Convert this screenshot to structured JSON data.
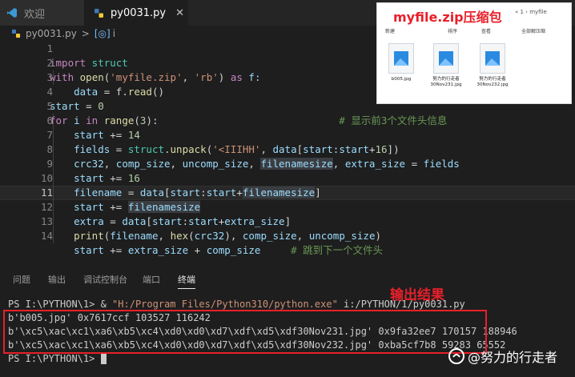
{
  "tabs": [
    {
      "label": "欢迎"
    },
    {
      "label": "py0031.py"
    }
  ],
  "breadcrumb": {
    "file": "py0031.py",
    "sep": ">",
    "symbol": "i"
  },
  "editor": {
    "line_numbers": [
      "1",
      "2",
      "3",
      "4",
      "5",
      "6",
      "7",
      "8",
      "9",
      "10",
      "11",
      "12",
      "13",
      "14"
    ],
    "current_line": "11",
    "code": {
      "l1": [
        "import",
        " struct"
      ],
      "l2": [
        "with",
        " ",
        "open",
        "(",
        "'myfile.zip'",
        ", ",
        "'rb'",
        ") ",
        "as",
        " f:"
      ],
      "l3": [
        "    data",
        " = f.",
        "read",
        "()"
      ],
      "l4": [
        "start",
        " = ",
        "0"
      ],
      "l5": [
        "for",
        " i ",
        "in",
        " ",
        "range",
        "(",
        "3",
        "):",
        "                              # 显示前3个文件头信息"
      ],
      "l6": [
        "    start",
        " += ",
        "14"
      ],
      "l7": [
        "    fields",
        " = ",
        "struct",
        ".",
        "unpack",
        "(",
        "'<IIIHH'",
        ", ",
        "data",
        "[",
        "start",
        ":",
        "start",
        "+",
        "16",
        "])"
      ],
      "l8": [
        "    crc32",
        ", ",
        "comp_size",
        ", ",
        "uncomp_size",
        ", ",
        "filenamesize",
        ", ",
        "extra_size",
        " = ",
        "fields"
      ],
      "l9": [
        "    start",
        " += ",
        "16"
      ],
      "l10": [
        "    filename",
        " = ",
        "data",
        "[",
        "start",
        ":",
        "start",
        "+",
        "filenamesize",
        "]"
      ],
      "l11": [
        "    start",
        " += ",
        "filenamesize"
      ],
      "l12": [
        "    extra",
        " = ",
        "data",
        "[",
        "start",
        ":",
        "start",
        "+",
        "extra_size",
        "]"
      ],
      "l13": [
        "    ",
        "print",
        "(",
        "filename",
        ", ",
        "hex",
        "(",
        "crc32",
        "), ",
        "comp_size",
        ", ",
        "uncomp_size",
        ")"
      ],
      "l14": [
        "    start",
        " += ",
        "extra_size",
        " + ",
        "comp_size",
        "     ",
        "# 跳到下一个文件头"
      ]
    }
  },
  "explorer": {
    "title": "myfile.zip压缩包",
    "path": "« 1 › myfile",
    "toolbar": [
      "新建",
      "排序",
      "查看",
      "全部解压缩"
    ],
    "files": [
      {
        "name": "b005.jpg"
      },
      {
        "name": "努力的行走者\n30Nov231.jpg"
      },
      {
        "name": "努力的行走者\n30Nov232.jpg"
      }
    ]
  },
  "panel": {
    "tabs": [
      "问题",
      "输出",
      "调试控制台",
      "端口",
      "终端"
    ],
    "active_tab": "终端"
  },
  "terminal": {
    "cmd_prefix": "PS I:\\PYTHON\\1> & ",
    "cmd_exe": "\"H:/Program Files/Python310/python.exe\"",
    "cmd_arg": " i:/PYTHON/1/py0031.py",
    "out1": "b'b005.jpg' 0x7617ccf 103527 116242",
    "out2": "b'\\xc5\\xac\\xc1\\xa6\\xb5\\xc4\\xd0\\xd0\\xd7\\xdf\\xd5\\xdf30Nov231.jpg' 0x9fa32ee7 170157 188946",
    "out3": "b'\\xc5\\xac\\xc1\\xa6\\xb5\\xc4\\xd0\\xd0\\xd7\\xdf\\xd5\\xdf30Nov232.jpg' 0xba5cf7b8 59283 65552",
    "prompt": "PS I:\\PYTHON\\1> "
  },
  "annotations": {
    "result_label": "输出结果",
    "watermark": "@努力的行走者"
  },
  "colors": {
    "annotation_red": "#e8202a",
    "keyword": "#c586c0",
    "function": "#dcdcaa",
    "string": "#ce9178",
    "number": "#b5cea8",
    "variable": "#9cdcfe",
    "comment": "#6a9955"
  }
}
